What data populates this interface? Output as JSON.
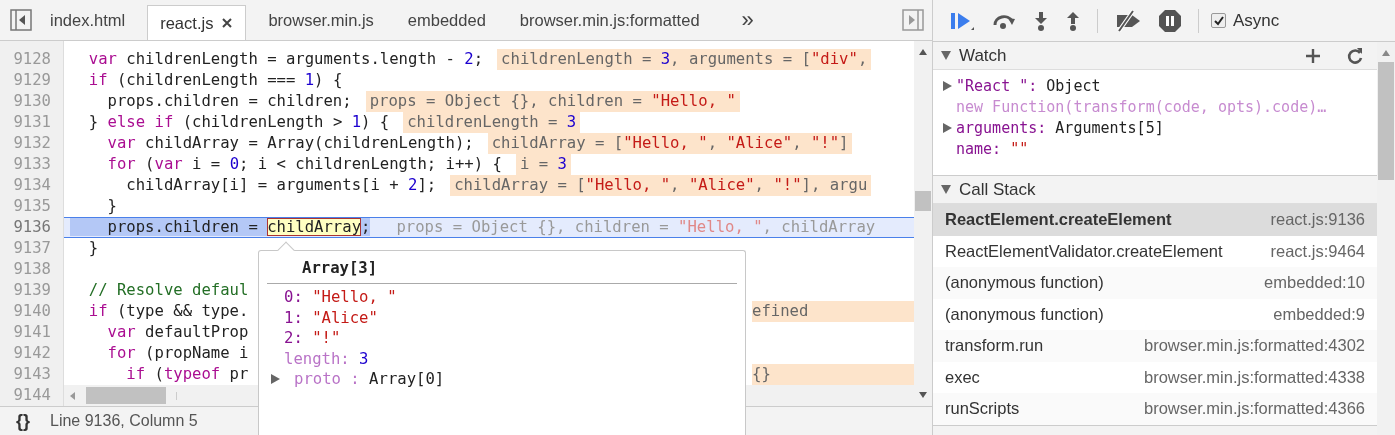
{
  "tabs": [
    {
      "label": "index.html",
      "selected": false
    },
    {
      "label": "react.js",
      "selected": true
    },
    {
      "label": "browser.min.js",
      "selected": false
    },
    {
      "label": "embedded",
      "selected": false
    },
    {
      "label": "browser.min.js:formatted",
      "selected": false
    }
  ],
  "tab_overflow": "»",
  "lines": [
    {
      "number": "9128",
      "current": false,
      "code": [
        {
          "text": "  var",
          "kind": "keyword"
        },
        {
          "text": " childrenLength = arguments.length - ",
          "kind": "plain"
        },
        {
          "text": "2",
          "kind": "number"
        },
        {
          "text": ";",
          "kind": "plain"
        }
      ],
      "value": [
        {
          "text": "childrenLength = ",
          "kind": "plain"
        },
        {
          "text": "3",
          "kind": "number"
        },
        {
          "text": ", arguments = [",
          "kind": "plain"
        },
        {
          "text": "\"div\"",
          "kind": "string"
        },
        {
          "text": ",",
          "kind": "plain"
        }
      ]
    },
    {
      "number": "9129",
      "current": false,
      "code": [
        {
          "text": "  if",
          "kind": "keyword"
        },
        {
          "text": " (childrenLength === ",
          "kind": "plain"
        },
        {
          "text": "1",
          "kind": "number"
        },
        {
          "text": ") {",
          "kind": "plain"
        }
      ]
    },
    {
      "number": "9130",
      "current": false,
      "code": [
        {
          "text": "    props.children = children;",
          "kind": "plain"
        }
      ],
      "value": [
        {
          "text": "props = Object {}, children = ",
          "kind": "plain"
        },
        {
          "text": "\"Hello, \"",
          "kind": "string"
        }
      ]
    },
    {
      "number": "9131",
      "current": false,
      "code": [
        {
          "text": "  } ",
          "kind": "plain"
        },
        {
          "text": "else if",
          "kind": "keyword"
        },
        {
          "text": " (childrenLength > ",
          "kind": "plain"
        },
        {
          "text": "1",
          "kind": "number"
        },
        {
          "text": ") {",
          "kind": "plain"
        }
      ],
      "value": [
        {
          "text": "childrenLength = ",
          "kind": "plain"
        },
        {
          "text": "3",
          "kind": "number"
        }
      ]
    },
    {
      "number": "9132",
      "current": false,
      "code": [
        {
          "text": "    var",
          "kind": "keyword"
        },
        {
          "text": " childArray = Array(childrenLength);",
          "kind": "plain"
        }
      ],
      "value": [
        {
          "text": "childArray = [",
          "kind": "plain"
        },
        {
          "text": "\"Hello, \"",
          "kind": "string"
        },
        {
          "text": ", ",
          "kind": "plain"
        },
        {
          "text": "\"Alice\"",
          "kind": "string"
        },
        {
          "text": ", ",
          "kind": "plain"
        },
        {
          "text": "\"!\"",
          "kind": "string"
        },
        {
          "text": "]",
          "kind": "plain"
        }
      ]
    },
    {
      "number": "9133",
      "current": false,
      "code": [
        {
          "text": "    for",
          "kind": "keyword"
        },
        {
          "text": " (",
          "kind": "plain"
        },
        {
          "text": "var",
          "kind": "keyword"
        },
        {
          "text": " i = ",
          "kind": "plain"
        },
        {
          "text": "0",
          "kind": "number"
        },
        {
          "text": "; i < childrenLength; i++) {",
          "kind": "plain"
        }
      ],
      "value": [
        {
          "text": "i = ",
          "kind": "plain"
        },
        {
          "text": "3",
          "kind": "number"
        }
      ]
    },
    {
      "number": "9134",
      "current": false,
      "code": [
        {
          "text": "      childArray[i] = arguments[i + ",
          "kind": "plain"
        },
        {
          "text": "2",
          "kind": "number"
        },
        {
          "text": "];",
          "kind": "plain"
        }
      ],
      "value": [
        {
          "text": "childArray = [",
          "kind": "plain"
        },
        {
          "text": "\"Hello, \"",
          "kind": "string"
        },
        {
          "text": ", ",
          "kind": "plain"
        },
        {
          "text": "\"Alice\"",
          "kind": "string"
        },
        {
          "text": ", ",
          "kind": "plain"
        },
        {
          "text": "\"!\"",
          "kind": "string"
        },
        {
          "text": "], argu",
          "kind": "plain"
        }
      ]
    },
    {
      "number": "9135",
      "current": false,
      "code": [
        {
          "text": "    }",
          "kind": "plain"
        }
      ]
    },
    {
      "number": "9136",
      "current": true,
      "code": [
        {
          "text": "    props.children = ",
          "kind": "selected"
        },
        {
          "text": "childArray",
          "kind": "hovered"
        },
        {
          "text": ";",
          "kind": "selected"
        }
      ],
      "value": [
        {
          "text": "props = Object {}, children = ",
          "kind": "plain"
        },
        {
          "text": "\"Hello, \"",
          "kind": "string"
        },
        {
          "text": ", childArray",
          "kind": "plain"
        }
      ]
    },
    {
      "number": "9137",
      "current": false,
      "code": [
        {
          "text": "  }",
          "kind": "plain"
        }
      ]
    },
    {
      "number": "9138",
      "current": false
    },
    {
      "number": "9139",
      "current": false,
      "code": [
        {
          "text": "  // Resolve defaul",
          "kind": "comment"
        }
      ]
    },
    {
      "number": "9140",
      "current": false,
      "code": [
        {
          "text": "  if",
          "kind": "keyword"
        },
        {
          "text": " (type && type.",
          "kind": "plain"
        }
      ],
      "obscured": true,
      "value": [
        {
          "text": "efined",
          "kind": "plain"
        }
      ]
    },
    {
      "number": "9141",
      "current": false,
      "code": [
        {
          "text": "    var",
          "kind": "keyword"
        },
        {
          "text": " defaultProp",
          "kind": "plain"
        }
      ]
    },
    {
      "number": "9142",
      "current": false,
      "code": [
        {
          "text": "    for",
          "kind": "keyword"
        },
        {
          "text": " (propName i",
          "kind": "plain"
        }
      ]
    },
    {
      "number": "9143",
      "current": false,
      "code": [
        {
          "text": "      if",
          "kind": "keyword"
        },
        {
          "text": " (",
          "kind": "plain"
        },
        {
          "text": "typeof",
          "kind": "keyword"
        },
        {
          "text": " pr",
          "kind": "plain"
        }
      ],
      "obscured": true,
      "value": [
        {
          "text": "{}",
          "kind": "plain"
        }
      ]
    },
    {
      "number": "9144",
      "current": false
    }
  ],
  "popover": {
    "title": "Array[3]",
    "entries": [
      {
        "kind": "primitive",
        "key": "0:",
        "value": {
          "text": "\"Hello, \"",
          "kind": "string"
        }
      },
      {
        "kind": "primitive",
        "key": "1:",
        "value": {
          "text": "\"Alice\"",
          "kind": "string"
        }
      },
      {
        "kind": "primitive",
        "key": "2:",
        "value": {
          "text": "\"!\"",
          "kind": "string"
        }
      },
      {
        "kind": "hidden",
        "key": "length:",
        "value": {
          "text": "3",
          "kind": "number"
        }
      },
      {
        "kind": "object",
        "key": "proto :",
        "value": {
          "text": "Array[0]",
          "kind": "object"
        }
      }
    ]
  },
  "status_bar": {
    "format_button": "{}",
    "position": "Line 9136, Column 5"
  },
  "debugger_toolbar": {
    "async": {
      "label": "Async",
      "checked": true
    }
  },
  "watch": {
    "title": "Watch",
    "expanded": true,
    "entries": [
      {
        "kind": "object",
        "key": "\"React \":",
        "value": {
          "text": "Object",
          "kind": "object"
        },
        "detail": "new Function(transform(code, opts).code)…"
      },
      {
        "kind": "object",
        "key": "arguments:",
        "value": {
          "text": "Arguments[5]",
          "kind": "object"
        }
      },
      {
        "kind": "primitive",
        "key": "name:",
        "value": {
          "text": "\"\"",
          "kind": "string"
        }
      }
    ]
  },
  "call_stack": {
    "title": "Call Stack",
    "expanded": true,
    "frames": [
      {
        "name": "ReactElement.createElement",
        "location": "react.js:9136",
        "selected": true
      },
      {
        "name": "ReactElementValidator.createElement",
        "location": "react.js:9464",
        "selected": false
      },
      {
        "name": "(anonymous function)",
        "location": "embedded:10",
        "selected": false
      },
      {
        "name": "(anonymous function)",
        "location": "embedded:9",
        "selected": false
      },
      {
        "name": "transform.run",
        "location": "browser.min.js:formatted:4302",
        "selected": false
      },
      {
        "name": "exec",
        "location": "browser.min.js:formatted:4338",
        "selected": false
      },
      {
        "name": "runScripts",
        "location": "browser.min.js:formatted:4366",
        "selected": false
      }
    ]
  }
}
